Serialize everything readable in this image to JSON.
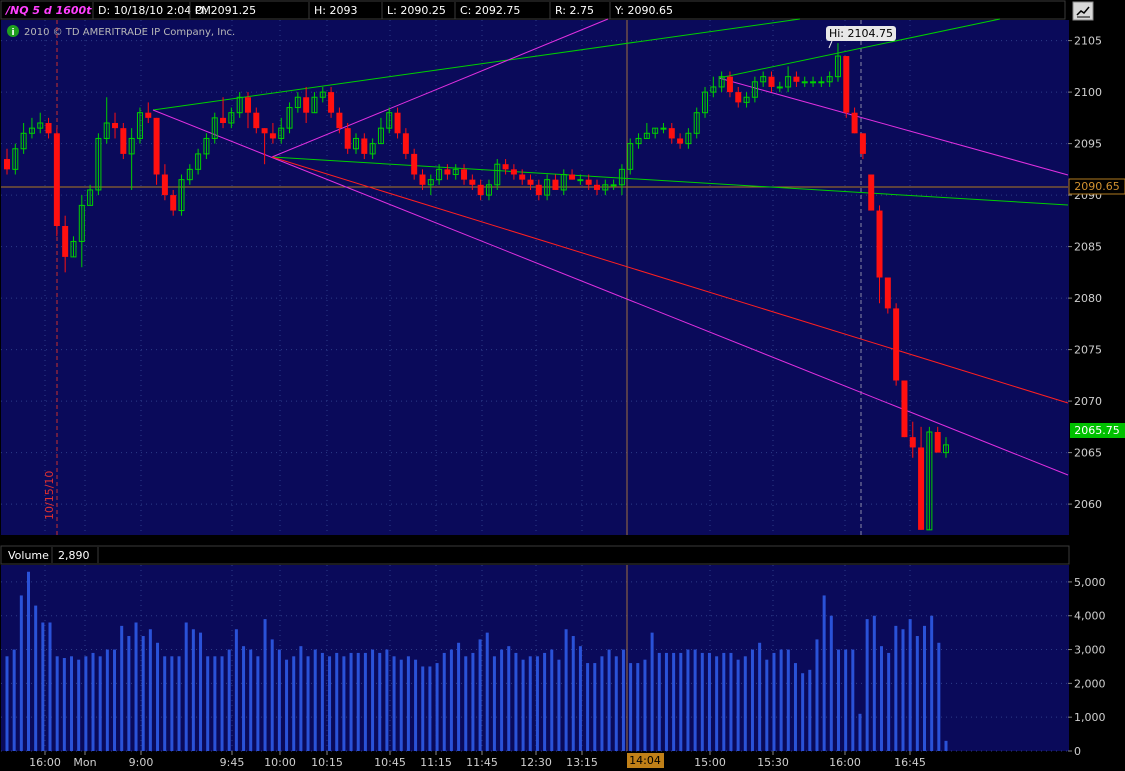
{
  "header": {
    "symbol": "/NQ 5 d 1600t",
    "fields": [
      "D: 10/18/10 2:04 PM",
      "O: 2091.25",
      "H: 2093",
      "L: 2090.25",
      "C: 2092.75",
      "R: 2.75",
      "Y: 2090.65"
    ]
  },
  "copyright": "2010 © TD AMERITRADE IP Company, Inc.",
  "colors": {
    "background": "#000000",
    "plot_bg": "#0a0a5a",
    "up": "#00d000",
    "down": "#ff1010",
    "volume_bar": "#2a52d8",
    "trend_green": "#00d000",
    "trend_magenta": "#e030e0",
    "trend_red": "#ff2020",
    "grid": "#2c3c88"
  },
  "chart_data": [
    {
      "type": "candlestick",
      "title": "/NQ 5 d 1600t",
      "y_ticks": [
        2060,
        2065,
        2070,
        2075,
        2080,
        2085,
        2090,
        2095,
        2100,
        2105
      ],
      "ylim": [
        2057,
        2107
      ],
      "x_ticks": [
        "16:00",
        "Mon",
        "9:00",
        "9:45",
        "10:00",
        "10:15",
        "10:45",
        "11:15",
        "11:45",
        "12:30",
        "13:15",
        "15:00",
        "15:30",
        "16:00",
        "16:45"
      ],
      "date_marker": "10/15/10",
      "hi_label": "Hi: 2104.75",
      "prev_close_label": "2090.65",
      "prev_close": 2090.65,
      "last_label": "2065.75",
      "last": 2065.75,
      "cursor_label": "14:04",
      "candles": [
        [
          2093.5,
          2094.5,
          2092,
          2092.5
        ],
        [
          2092.5,
          2095,
          2092,
          2094.5
        ],
        [
          2094.5,
          2097,
          2094,
          2096
        ],
        [
          2096,
          2097.5,
          2095.5,
          2096.5
        ],
        [
          2096.5,
          2098,
          2096,
          2097
        ],
        [
          2097,
          2097.5,
          2095.5,
          2096
        ],
        [
          2096,
          2096.5,
          2086,
          2087
        ],
        [
          2087,
          2088,
          2082.5,
          2084
        ],
        [
          2084,
          2086,
          2084,
          2085.5
        ],
        [
          2085.5,
          2090,
          2083,
          2089
        ],
        [
          2089,
          2091,
          2089,
          2090.5
        ],
        [
          2090.5,
          2096,
          2090,
          2095.5
        ],
        [
          2095.5,
          2099.5,
          2095,
          2097
        ],
        [
          2097,
          2098,
          2095.5,
          2096.5
        ],
        [
          2096.5,
          2097,
          2093.5,
          2094
        ],
        [
          2094,
          2096.5,
          2090.5,
          2095.5
        ],
        [
          2095.5,
          2098.5,
          2095,
          2098
        ],
        [
          2098,
          2099,
          2097,
          2097.5
        ],
        [
          2097.5,
          2097.5,
          2091,
          2092
        ],
        [
          2092,
          2093,
          2089.5,
          2090
        ],
        [
          2090,
          2090.5,
          2088,
          2088.5
        ],
        [
          2088.5,
          2092,
          2088,
          2091.5
        ],
        [
          2091.5,
          2093,
          2091,
          2092.5
        ],
        [
          2092.5,
          2094.5,
          2092,
          2094
        ],
        [
          2094,
          2096,
          2093.5,
          2095.5
        ],
        [
          2095.5,
          2098,
          2095,
          2097.5
        ],
        [
          2097.5,
          2099.5,
          2096.5,
          2097
        ],
        [
          2097,
          2098.5,
          2096.5,
          2098
        ],
        [
          2098,
          2100,
          2097.5,
          2099.5
        ],
        [
          2099.5,
          2100,
          2096.5,
          2098
        ],
        [
          2098,
          2098.5,
          2096,
          2096.5
        ],
        [
          2096.5,
          2096.5,
          2093,
          2096
        ],
        [
          2096,
          2097,
          2095,
          2095.5
        ],
        [
          2095.5,
          2097.5,
          2095,
          2096.5
        ],
        [
          2096.5,
          2099,
          2096,
          2098.5
        ],
        [
          2098.5,
          2100,
          2098,
          2099.5
        ],
        [
          2099.5,
          2100.5,
          2097,
          2098
        ],
        [
          2098,
          2100,
          2098,
          2099.5
        ],
        [
          2099.5,
          2100.5,
          2099,
          2100
        ],
        [
          2100,
          2100.5,
          2097.5,
          2098
        ],
        [
          2098,
          2098.5,
          2096,
          2096.5
        ],
        [
          2096.5,
          2097,
          2094,
          2094.5
        ],
        [
          2094.5,
          2096,
          2094,
          2095.5
        ],
        [
          2095.5,
          2096,
          2093.5,
          2094
        ],
        [
          2094,
          2095.5,
          2093.5,
          2095
        ],
        [
          2095,
          2097.5,
          2095,
          2096.5
        ],
        [
          2096.5,
          2098.5,
          2096,
          2098
        ],
        [
          2098,
          2098.5,
          2095.5,
          2096
        ],
        [
          2096,
          2096.5,
          2093.5,
          2094
        ],
        [
          2094,
          2094.5,
          2091.5,
          2092
        ],
        [
          2092,
          2092.5,
          2090.5,
          2091
        ],
        [
          2091,
          2092,
          2090,
          2091.5
        ],
        [
          2091.5,
          2093,
          2091,
          2092.5
        ],
        [
          2092.5,
          2093,
          2091.5,
          2092
        ],
        [
          2092,
          2093,
          2091.5,
          2092.5
        ],
        [
          2092.5,
          2093,
          2091,
          2091.5
        ],
        [
          2091.5,
          2092,
          2090.5,
          2091
        ],
        [
          2091,
          2091.5,
          2089.5,
          2090
        ],
        [
          2090,
          2091.5,
          2089.5,
          2091
        ],
        [
          2091,
          2093.5,
          2090.5,
          2093
        ],
        [
          2093,
          2093.5,
          2092,
          2092.5
        ],
        [
          2092.5,
          2093,
          2091.5,
          2092
        ],
        [
          2092,
          2092.5,
          2091,
          2091.5
        ],
        [
          2091.5,
          2092,
          2090.5,
          2091
        ],
        [
          2091,
          2091.5,
          2089.5,
          2090
        ],
        [
          2090,
          2092,
          2089.5,
          2091.5
        ],
        [
          2091.5,
          2092,
          2090.5,
          2090.5
        ],
        [
          2090.5,
          2092.5,
          2090,
          2092
        ],
        [
          2092,
          2092.5,
          2091.5,
          2091.5
        ],
        [
          2091.5,
          2092,
          2091,
          2091.5
        ],
        [
          2091.5,
          2092,
          2090.5,
          2091
        ],
        [
          2091,
          2091.5,
          2090,
          2090.5
        ],
        [
          2090.5,
          2091.5,
          2090,
          2091
        ],
        [
          2091,
          2091.5,
          2090.5,
          2091
        ],
        [
          2091,
          2093,
          2090,
          2092.5
        ],
        [
          2092.5,
          2095.5,
          2092,
          2095
        ],
        [
          2095,
          2096,
          2094.5,
          2095.5
        ],
        [
          2095.5,
          2097,
          2095.5,
          2096
        ],
        [
          2096,
          2096.5,
          2095.5,
          2096.5
        ],
        [
          2096.5,
          2097,
          2096,
          2096.5
        ],
        [
          2096.5,
          2097,
          2095,
          2095.5
        ],
        [
          2095.5,
          2096,
          2094.5,
          2095
        ],
        [
          2095,
          2096.5,
          2094.5,
          2096
        ],
        [
          2096,
          2098.5,
          2095.5,
          2098
        ],
        [
          2098,
          2100.5,
          2097.5,
          2100
        ],
        [
          2100,
          2101.5,
          2099.5,
          2100.5
        ],
        [
          2100.5,
          2102,
          2100,
          2101.5
        ],
        [
          2101.5,
          2102,
          2099.5,
          2100
        ],
        [
          2100,
          2100.5,
          2098.5,
          2099
        ],
        [
          2099,
          2100,
          2098.5,
          2099.5
        ],
        [
          2099.5,
          2101.5,
          2099,
          2101
        ],
        [
          2101,
          2102,
          2100.5,
          2101.5
        ],
        [
          2101.5,
          2102,
          2100,
          2100.5
        ],
        [
          2100.5,
          2101,
          2100,
          2100.5
        ],
        [
          2100.5,
          2102.5,
          2100,
          2101.5
        ],
        [
          2101.5,
          2102,
          2100.5,
          2101
        ],
        [
          2101,
          2101.5,
          2100.5,
          2101
        ],
        [
          2101,
          2101.5,
          2100.5,
          2101
        ],
        [
          2101,
          2101.5,
          2100.5,
          2101
        ],
        [
          2101,
          2102,
          2100.5,
          2101.5
        ],
        [
          2101.5,
          2104.75,
          2101,
          2103.5
        ],
        [
          2103.5,
          2103.5,
          2097.5,
          2098
        ],
        [
          2098,
          2098.5,
          2096,
          2096
        ],
        [
          2096,
          2096,
          2093.5,
          2094
        ],
        [
          2092,
          2092,
          2088.5,
          2088.5
        ],
        [
          2088.5,
          2089,
          2079.5,
          2082
        ],
        [
          2082,
          2082,
          2078.5,
          2079
        ],
        [
          2079,
          2079.5,
          2071.5,
          2072
        ],
        [
          2072,
          2072,
          2066.5,
          2066.5
        ],
        [
          2066.5,
          2068,
          2064.5,
          2065.5
        ],
        [
          2065.5,
          2067.5,
          2057.5,
          2057.5
        ],
        [
          2057.5,
          2067.5,
          2057.5,
          2067
        ],
        [
          2067,
          2067.5,
          2065.5,
          2065
        ],
        [
          2065,
          2066.5,
          2064.5,
          2065.75
        ]
      ]
    },
    {
      "type": "bar",
      "title": "Volume",
      "value_label": "2,890",
      "y_ticks": [
        "0",
        "1,000",
        "2,000",
        "3,000",
        "4,000",
        "5,000"
      ],
      "ylim": [
        0,
        5500
      ],
      "values": [
        2800,
        3000,
        4600,
        5300,
        4300,
        3800,
        3800,
        2800,
        2750,
        2800,
        2700,
        2800,
        2900,
        2800,
        3000,
        3000,
        3700,
        3400,
        3800,
        3400,
        3600,
        3200,
        2800,
        2800,
        2800,
        3800,
        3600,
        3500,
        2800,
        2800,
        2800,
        3000,
        3600,
        3100,
        3000,
        2800,
        3900,
        3300,
        3000,
        2700,
        2800,
        3100,
        2800,
        3000,
        2900,
        2800,
        2900,
        2800,
        2900,
        2900,
        2900,
        3000,
        2900,
        3000,
        2800,
        2700,
        2800,
        2700,
        2500,
        2500,
        2600,
        2900,
        3000,
        3200,
        2800,
        2900,
        3300,
        3500,
        2800,
        3000,
        3100,
        2900,
        2700,
        2800,
        2800,
        2900,
        3000,
        2700,
        3600,
        3400,
        3100,
        2600,
        2600,
        2800,
        3000,
        2800,
        3000,
        2600,
        2600,
        2700,
        3500,
        2900,
        2900,
        2900,
        2900,
        3000,
        3000,
        2900,
        2900,
        2800,
        2900,
        2900,
        2700,
        2800,
        3000,
        3200,
        2700,
        2900,
        3000,
        3000,
        2600,
        2300,
        2400,
        3300,
        4600,
        4000,
        3000,
        3000,
        3000,
        1100,
        3900,
        4000,
        3100,
        2900,
        3700,
        3600,
        3900,
        3400,
        3700,
        4000,
        3200,
        300
      ]
    }
  ]
}
